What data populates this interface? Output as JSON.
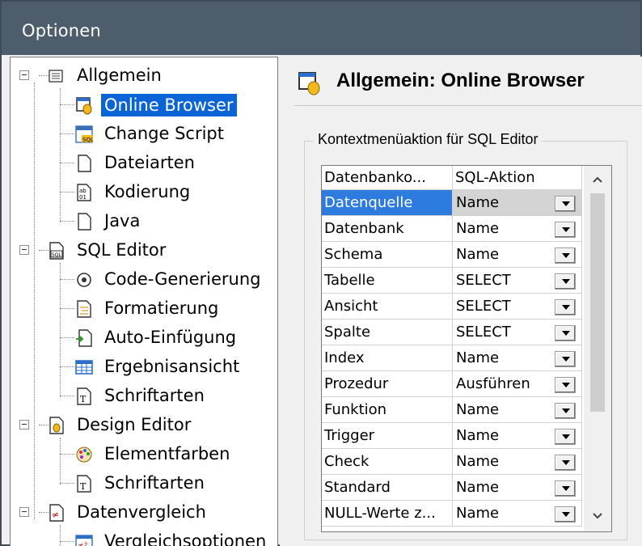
{
  "window": {
    "title": "Optionen"
  },
  "tree": {
    "items": [
      {
        "label": "Allgemein",
        "icon": "general-settings-icon"
      },
      {
        "label": "Online Browser",
        "icon": "online-browser-icon"
      },
      {
        "label": "Change Script",
        "icon": "change-script-icon"
      },
      {
        "label": "Dateiarten",
        "icon": "file-types-icon"
      },
      {
        "label": "Kodierung",
        "icon": "encoding-icon"
      },
      {
        "label": "Java",
        "icon": "java-icon"
      },
      {
        "label": "SQL Editor",
        "icon": "sql-editor-icon"
      },
      {
        "label": "Code-Generierung",
        "icon": "code-generation-icon"
      },
      {
        "label": "Formatierung",
        "icon": "formatting-icon"
      },
      {
        "label": "Auto-Einfügung",
        "icon": "auto-insertion-icon"
      },
      {
        "label": "Ergebnisansicht",
        "icon": "result-view-icon"
      },
      {
        "label": "Schriftarten",
        "icon": "fonts-icon"
      },
      {
        "label": "Design Editor",
        "icon": "design-editor-icon"
      },
      {
        "label": "Elementfarben",
        "icon": "palette-icon"
      },
      {
        "label": "Schriftarten",
        "icon": "fonts-icon"
      },
      {
        "label": "Datenvergleich",
        "icon": "data-compare-icon"
      },
      {
        "label": "Vergleichsoptionen",
        "icon": "compare-options-icon"
      }
    ],
    "selected": "Online Browser"
  },
  "panel": {
    "heading": "Allgemein: Online Browser",
    "group_title": "Kontextmenüaktion für SQL Editor",
    "columns": [
      "Datenbanko...",
      "SQL-Aktion"
    ],
    "rows": [
      {
        "object": "Datenquelle",
        "action": "Name"
      },
      {
        "object": "Datenbank",
        "action": "Name"
      },
      {
        "object": "Schema",
        "action": "Name"
      },
      {
        "object": "Tabelle",
        "action": "SELECT"
      },
      {
        "object": "Ansicht",
        "action": "SELECT"
      },
      {
        "object": "Spalte",
        "action": "SELECT"
      },
      {
        "object": "Index",
        "action": "Name"
      },
      {
        "object": "Prozedur",
        "action": "Ausführen"
      },
      {
        "object": "Funktion",
        "action": "Name"
      },
      {
        "object": "Trigger",
        "action": "Name"
      },
      {
        "object": "Check",
        "action": "Name"
      },
      {
        "object": "Standard",
        "action": "Name"
      },
      {
        "object": "NULL-Werte z...",
        "action": "Name"
      }
    ],
    "active_row": "Datenquelle"
  },
  "colors": {
    "titlebar": "#4d5d6b",
    "selection": "#0a64d6",
    "active_cell": "#2e7be0"
  }
}
